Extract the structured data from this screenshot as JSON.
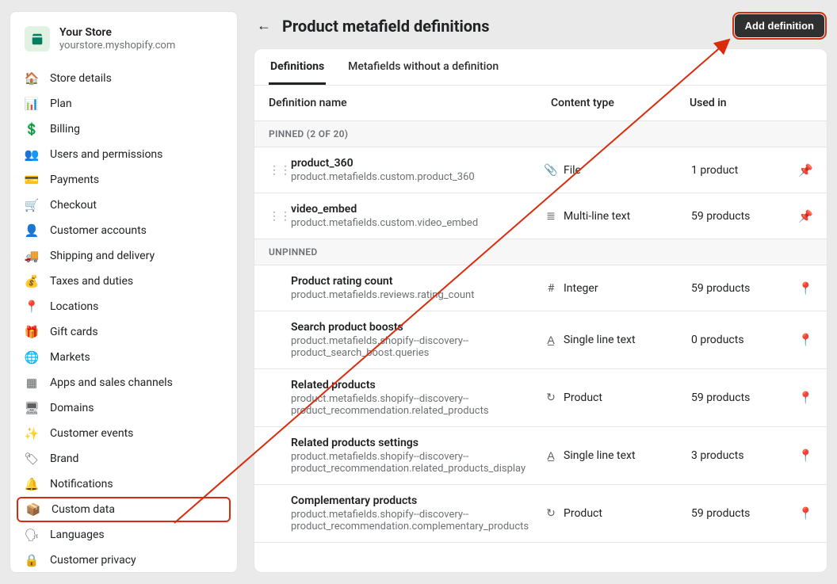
{
  "store": {
    "name": "Your Store",
    "domain": "yourstore.myshopify.com"
  },
  "sidebar": {
    "items": [
      {
        "label": "Store details",
        "icon": "🏠"
      },
      {
        "label": "Plan",
        "icon": "📊"
      },
      {
        "label": "Billing",
        "icon": "💲"
      },
      {
        "label": "Users and permissions",
        "icon": "👥"
      },
      {
        "label": "Payments",
        "icon": "💳"
      },
      {
        "label": "Checkout",
        "icon": "🛒"
      },
      {
        "label": "Customer accounts",
        "icon": "👤"
      },
      {
        "label": "Shipping and delivery",
        "icon": "🚚"
      },
      {
        "label": "Taxes and duties",
        "icon": "💰"
      },
      {
        "label": "Locations",
        "icon": "📍"
      },
      {
        "label": "Gift cards",
        "icon": "🎁"
      },
      {
        "label": "Markets",
        "icon": "🌐"
      },
      {
        "label": "Apps and sales channels",
        "icon": "▦"
      },
      {
        "label": "Domains",
        "icon": "🖥"
      },
      {
        "label": "Customer events",
        "icon": "✨"
      },
      {
        "label": "Brand",
        "icon": "🏷"
      },
      {
        "label": "Notifications",
        "icon": "🔔"
      },
      {
        "label": "Custom data",
        "icon": "📦"
      },
      {
        "label": "Languages",
        "icon": "🗣"
      },
      {
        "label": "Customer privacy",
        "icon": "🔒"
      }
    ],
    "active_index": 17
  },
  "page": {
    "title": "Product metafield definitions",
    "add_button": "Add definition"
  },
  "tabs": [
    {
      "label": "Definitions",
      "active": true
    },
    {
      "label": "Metafields without a definition",
      "active": false
    }
  ],
  "columns": {
    "name": "Definition name",
    "type": "Content type",
    "used": "Used in"
  },
  "sections": {
    "pinned_label": "PINNED (2 OF 20)",
    "unpinned_label": "UNPINNED"
  },
  "pinned": [
    {
      "title": "product_360",
      "path": "product.metafields.custom.product_360",
      "type_icon": "📎",
      "type": "File",
      "used": "1 product"
    },
    {
      "title": "video_embed",
      "path": "product.metafields.custom.video_embed",
      "type_icon": "≣",
      "type": "Multi-line text",
      "used": "59 products"
    }
  ],
  "unpinned": [
    {
      "title": "Product rating count",
      "path": "product.metafields.reviews.rating_count",
      "type_icon": "#",
      "type": "Integer",
      "used": "59 products"
    },
    {
      "title": "Search product boosts",
      "path": "product.metafields.shopify--discovery--product_search_boost.queries",
      "type_icon": "A̲",
      "type": "Single line text",
      "used": "0 products"
    },
    {
      "title": "Related products",
      "path": "product.metafields.shopify--discovery--product_recommendation.related_products",
      "type_icon": "↻",
      "type": "Product",
      "used": "59 products"
    },
    {
      "title": "Related products settings",
      "path": "product.metafields.shopify--discovery--product_recommendation.related_products_display",
      "type_icon": "A̲",
      "type": "Single line text",
      "used": "3 products"
    },
    {
      "title": "Complementary products",
      "path": "product.metafields.shopify--discovery--product_recommendation.complementary_products",
      "type_icon": "↻",
      "type": "Product",
      "used": "59 products"
    }
  ]
}
